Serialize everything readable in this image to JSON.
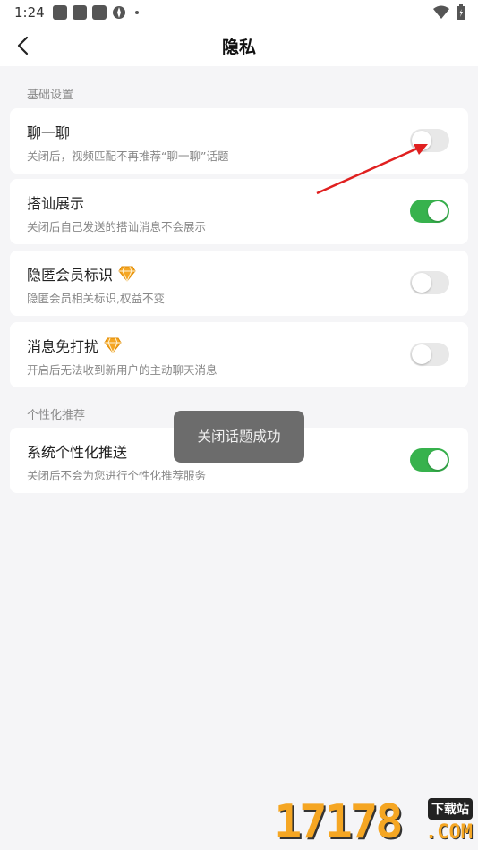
{
  "status_bar": {
    "time": "1:24"
  },
  "nav": {
    "title": "隐私"
  },
  "sections": [
    {
      "label": "基础设置"
    },
    {
      "label": "个性化推荐"
    }
  ],
  "settings": [
    {
      "title": "聊一聊",
      "desc": "关闭后，视频匹配不再推荐“聊一聊”话题",
      "enabled": false,
      "vip": false
    },
    {
      "title": "搭讪展示",
      "desc": "关闭后自己发送的搭讪消息不会展示",
      "enabled": true,
      "vip": false
    },
    {
      "title": "隐匿会员标识",
      "desc": "隐匿会员相关标识,权益不变",
      "enabled": false,
      "vip": true
    },
    {
      "title": "消息免打扰",
      "desc": "开启后无法收到新用户的主动聊天消息",
      "enabled": false,
      "vip": true
    },
    {
      "title": "系统个性化推送",
      "desc": "关闭后不会为您进行个性化推荐服务",
      "enabled": true,
      "vip": false
    }
  ],
  "toast": {
    "text": "关闭话题成功"
  },
  "watermark": {
    "digits": "17178",
    "tag": "下载站",
    "suffix": ".COM"
  },
  "colors": {
    "toggle_on": "#37b24d",
    "toggle_off": "#e8e8e8",
    "annotation_arrow": "#e02020",
    "gem": "#f5a623"
  }
}
